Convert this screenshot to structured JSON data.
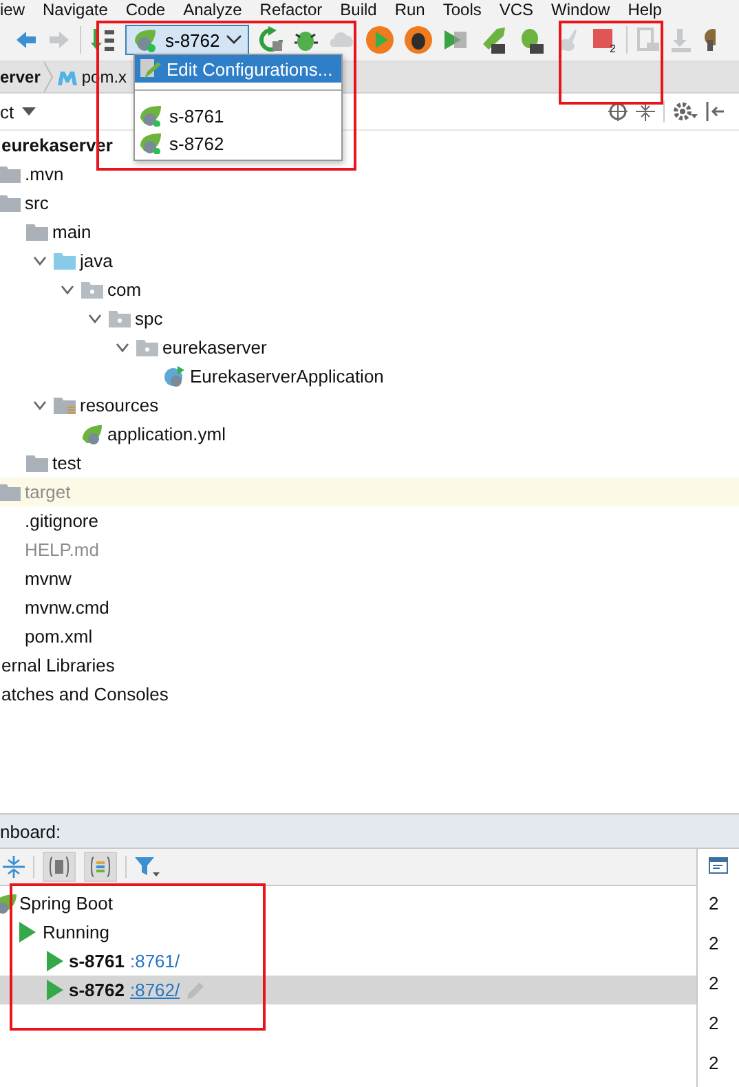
{
  "menu_bar": [
    "iew",
    "Navigate",
    "Code",
    "Analyze",
    "Refactor",
    "Build",
    "Run",
    "Tools",
    "VCS",
    "Window",
    "Help"
  ],
  "toolbar": {
    "run_config": "s-8762",
    "stop_badge": "2"
  },
  "run_config_menu": [
    {
      "label": "Edit Configurations...",
      "kind": "edit",
      "selected": true
    },
    {
      "label": "s-8761",
      "kind": "config",
      "selected": false
    },
    {
      "label": "s-8762",
      "kind": "config",
      "selected": false
    }
  ],
  "breadcrumb": [
    "erver",
    "pom.x"
  ],
  "project_panel": {
    "title": "ct"
  },
  "project_tree": [
    {
      "label": "eurekaserver",
      "kind": "module",
      "children": [
        {
          "label": ".mvn",
          "kind": "folder"
        },
        {
          "label": "src",
          "kind": "folder",
          "children": [
            {
              "label": "main",
              "kind": "folder",
              "children": [
                {
                  "label": "java",
                  "kind": "source",
                  "expanded": true,
                  "children": [
                    {
                      "label": "com",
                      "kind": "package",
                      "expanded": true,
                      "children": [
                        {
                          "label": "spc",
                          "kind": "package",
                          "expanded": true,
                          "children": [
                            {
                              "label": "eurekaserver",
                              "kind": "package",
                              "expanded": true,
                              "children": [
                                {
                                  "label": "EurekaserverApplication",
                                  "kind": "spring-class"
                                }
                              ]
                            }
                          ]
                        }
                      ]
                    }
                  ]
                },
                {
                  "label": "resources",
                  "kind": "resources",
                  "expanded": true,
                  "children": [
                    {
                      "label": "application.yml",
                      "kind": "spring-file"
                    }
                  ]
                }
              ]
            },
            {
              "label": "test",
              "kind": "folder"
            }
          ]
        },
        {
          "label": "target",
          "kind": "folder",
          "excluded": true
        },
        {
          "label": ".gitignore",
          "kind": "file"
        },
        {
          "label": "HELP.md",
          "kind": "file",
          "ignored": true
        },
        {
          "label": "mvnw",
          "kind": "file"
        },
        {
          "label": "mvnw.cmd",
          "kind": "file"
        },
        {
          "label": "pom.xml",
          "kind": "file"
        }
      ]
    },
    {
      "label": "ernal Libraries",
      "kind": "root"
    },
    {
      "label": "atches and Consoles",
      "kind": "root"
    }
  ],
  "dashboard": {
    "title": "nboard:",
    "group": "Spring Boot",
    "status": "Running",
    "apps": [
      {
        "name": "s-8761",
        "port": ":8761/",
        "selected": false
      },
      {
        "name": "s-8762",
        "port": ":8762/",
        "selected": true
      }
    ],
    "console_lines": [
      "2",
      "2",
      "2",
      "2",
      "2"
    ]
  }
}
